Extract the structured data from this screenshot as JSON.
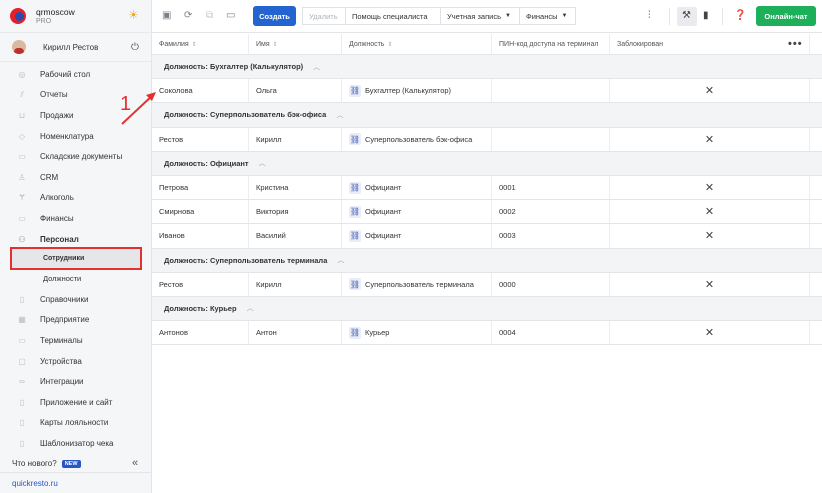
{
  "brand": {
    "name": "qrmoscow",
    "plan": "PRO"
  },
  "user": {
    "name": "Кирилл Рестов"
  },
  "sidebar": {
    "items": [
      {
        "label": "Рабочий стол",
        "icon": "gauge-icon",
        "glyph": "◎"
      },
      {
        "label": "Отчеты",
        "icon": "chart-icon",
        "glyph": "⫽"
      },
      {
        "label": "Продажи",
        "icon": "cart-icon",
        "glyph": "⊔"
      },
      {
        "label": "Номенклатура",
        "icon": "tag-icon",
        "glyph": "◇"
      },
      {
        "label": "Складские документы",
        "icon": "box-icon",
        "glyph": "▭"
      },
      {
        "label": "CRM",
        "icon": "crm-icon",
        "glyph": "♙"
      },
      {
        "label": "Алкоголь",
        "icon": "glass-icon",
        "glyph": "Ɏ"
      },
      {
        "label": "Финансы",
        "icon": "wallet-icon",
        "glyph": "▭"
      },
      {
        "label": "Персонал",
        "icon": "people-icon",
        "glyph": "⚇"
      }
    ],
    "subitems": [
      {
        "label": "Сотрудники",
        "active": true
      },
      {
        "label": "Должности",
        "active": false
      }
    ],
    "items2": [
      {
        "label": "Справочники",
        "icon": "book-icon",
        "glyph": "▯"
      },
      {
        "label": "Предприятие",
        "icon": "building-icon",
        "glyph": "▦"
      },
      {
        "label": "Терминалы",
        "icon": "terminal-icon",
        "glyph": "▭"
      },
      {
        "label": "Устройства",
        "icon": "device-icon",
        "glyph": "▢"
      },
      {
        "label": "Интеграции",
        "icon": "link-chain-icon",
        "glyph": "∞"
      },
      {
        "label": "Приложение и сайт",
        "icon": "phone-icon",
        "glyph": "▯"
      },
      {
        "label": "Карты лояльности",
        "icon": "card-icon",
        "glyph": "▯"
      },
      {
        "label": "Шаблонизатор чека",
        "icon": "receipt-icon",
        "glyph": "▯"
      }
    ],
    "whats_new": "Что нового?",
    "new_badge": "NEW",
    "footer_link": "quickresto.ru"
  },
  "toolbar": {
    "create": "Создать",
    "delete": "Удалить",
    "help": "Помощь специалиста",
    "account": "Учетная запись",
    "finance": "Финансы",
    "chat": "Онлайн-чат"
  },
  "table": {
    "columns": [
      "Фамилия",
      "Имя",
      "Должность",
      "ПИН-код доступа на терминал",
      "Заблокирован"
    ],
    "groups": [
      {
        "title": "Должность: Бухгалтер (Калькулятор)",
        "rows": [
          {
            "last": "Соколова",
            "first": "Ольга",
            "position": "Бухгалтер (Калькулятор)",
            "pin": "",
            "blocked": "✕"
          }
        ]
      },
      {
        "title": "Должность: Суперпользователь бэк-офиса",
        "rows": [
          {
            "last": "Рестов",
            "first": "Кирилл",
            "position": "Суперпользователь бэк-офиса",
            "pin": "",
            "blocked": "✕"
          }
        ]
      },
      {
        "title": "Должность: Официант",
        "rows": [
          {
            "last": "Петрова",
            "first": "Кристина",
            "position": "Официант",
            "pin": "0001",
            "blocked": "✕"
          },
          {
            "last": "Смирнова",
            "first": "Виктория",
            "position": "Официант",
            "pin": "0002",
            "blocked": "✕"
          },
          {
            "last": "Иванов",
            "first": "Василий",
            "position": "Официант",
            "pin": "0003",
            "blocked": "✕"
          }
        ]
      },
      {
        "title": "Должность: Суперпользователь терминала",
        "rows": [
          {
            "last": "Рестов",
            "first": "Кирилл",
            "position": "Суперпользователь терминала",
            "pin": "0000",
            "blocked": "✕"
          }
        ]
      },
      {
        "title": "Должность: Курьер",
        "rows": [
          {
            "last": "Антонов",
            "first": "Антон",
            "position": "Курьер",
            "pin": "0004",
            "blocked": "✕"
          }
        ]
      }
    ]
  },
  "annotation": {
    "number": "1",
    "color": "#e53030"
  },
  "colors": {
    "primary": "#2464d0",
    "chat": "#1eaf5a",
    "highlight": "#e53030"
  }
}
